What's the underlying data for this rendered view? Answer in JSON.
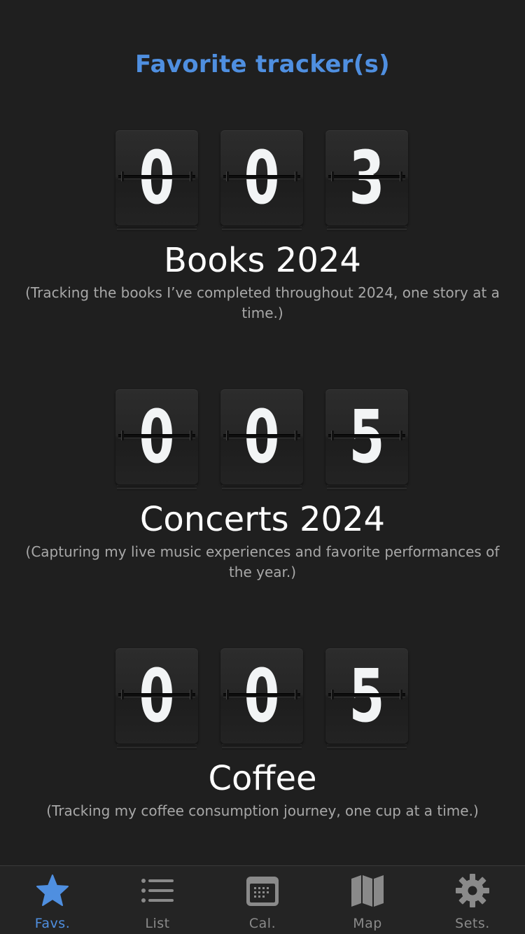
{
  "header": {
    "title": "Favorite tracker(s)"
  },
  "trackers": [
    {
      "digits": [
        "0",
        "0",
        "3"
      ],
      "name": "Books 2024",
      "description": "(Tracking the books I’ve completed throughout 2024, one story at a time.)"
    },
    {
      "digits": [
        "0",
        "0",
        "5"
      ],
      "name": "Concerts 2024",
      "description": "(Capturing my live music experiences and favorite performances of the year.)"
    },
    {
      "digits": [
        "0",
        "0",
        "5"
      ],
      "name": "Coffee",
      "description": "(Tracking my coffee consumption journey, one cup at a time.)"
    }
  ],
  "tabs": [
    {
      "label": "Favs.",
      "icon": "star-icon",
      "active": true
    },
    {
      "label": "List",
      "icon": "list-icon",
      "active": false
    },
    {
      "label": "Cal.",
      "icon": "calendar-icon",
      "active": false
    },
    {
      "label": "Map",
      "icon": "map-icon",
      "active": false
    },
    {
      "label": "Sets.",
      "icon": "gear-icon",
      "active": false
    }
  ],
  "colors": {
    "accent": "#4f8fe0",
    "background": "#1f1f1f",
    "inactive": "#8a8a8a"
  }
}
